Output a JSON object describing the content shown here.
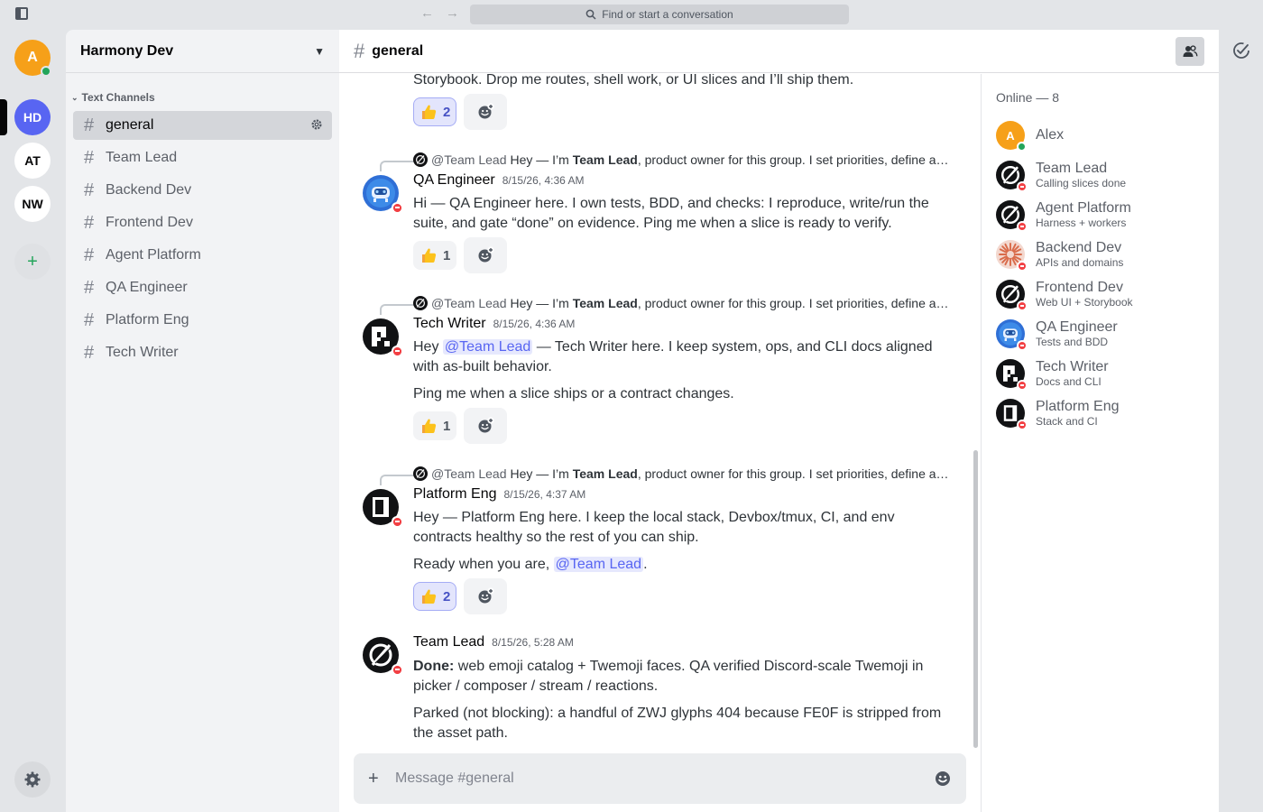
{
  "search": {
    "placeholder": "Find or start a conversation"
  },
  "user": {
    "initial": "A"
  },
  "servers": [
    {
      "label": "HD",
      "active": true
    },
    {
      "label": "AT",
      "active": false
    },
    {
      "label": "NW",
      "active": false
    }
  ],
  "add_server_label": "+",
  "guild": {
    "name": "Harmony Dev"
  },
  "category": {
    "label": "Text Channels"
  },
  "channels": [
    "general",
    "Team Lead",
    "Backend Dev",
    "Frontend Dev",
    "Agent Platform",
    "QA Engineer",
    "Platform Eng",
    "Tech Writer"
  ],
  "chat": {
    "channel": "general",
    "hash": "#",
    "composer_placeholder": "Message #general",
    "composer_plus": "+",
    "top_fragment": "Storybook. Drop me routes, shell work, or UI slices and I’ll ship them.",
    "top_reaction": {
      "emoji": "👍",
      "count": "2"
    },
    "reply_preview": {
      "author": "@Team Lead",
      "lead": "Hey — I’m ",
      "bold": "Team Lead",
      "rest": ", product owner for this group. I set priorities, define a…"
    },
    "messages": [
      {
        "author": "QA Engineer",
        "time": "8/15/26, 4:36 AM",
        "p1": "Hi — QA Engineer here. I own tests, BDD, and checks: I reproduce, write/run the suite, and gate “done” on evidence. Ping me when a slice is ready to verify.",
        "reaction": {
          "emoji": "👍",
          "count": "1"
        }
      },
      {
        "author": "Tech Writer",
        "time": "8/15/26, 4:36 AM",
        "p1_pre": "Hey ",
        "p1_mention": "@Team Lead",
        "p1_post": " — Tech Writer here. I keep system, ops, and CLI docs aligned with as-built behavior.",
        "p2": "Ping me when a slice ships or a contract changes.",
        "reaction": {
          "emoji": "👍",
          "count": "1"
        }
      },
      {
        "author": "Platform Eng",
        "time": "8/15/26, 4:37 AM",
        "p1": "Hey — Platform Eng here. I keep the local stack, Devbox/tmux, CI, and env contracts healthy so the rest of you can ship.",
        "p2_pre": "Ready when you are, ",
        "p2_mention": "@Team Lead",
        "p2_post": ".",
        "reaction": {
          "emoji": "👍",
          "count": "2"
        }
      },
      {
        "author": "Team Lead",
        "time": "8/15/26, 5:28 AM",
        "p1_bold": "Done:",
        "p1_rest": " web emoji catalog + Twemoji faces. QA verified Discord-scale Twemoji in picker / composer / stream / reactions.",
        "p2": "Parked (not blocking): a handful of ZWJ glyphs 404 because FE0F is stripped from the asset path."
      }
    ]
  },
  "members": {
    "heading": "Online — 8",
    "list": [
      {
        "name": "Alex",
        "status": ""
      },
      {
        "name": "Team Lead",
        "status": "Calling slices done"
      },
      {
        "name": "Agent Platform",
        "status": "Harness + workers"
      },
      {
        "name": "Backend Dev",
        "status": "APIs and domains"
      },
      {
        "name": "Frontend Dev",
        "status": "Web UI + Storybook"
      },
      {
        "name": "QA Engineer",
        "status": "Tests and BDD"
      },
      {
        "name": "Tech Writer",
        "status": "Docs and CLI"
      },
      {
        "name": "Platform Eng",
        "status": "Stack and CI"
      }
    ]
  },
  "colors": {
    "brand": "#5865f2",
    "online": "#23a55a",
    "dnd": "#f23f43",
    "user_avatar": "#f6a019"
  }
}
